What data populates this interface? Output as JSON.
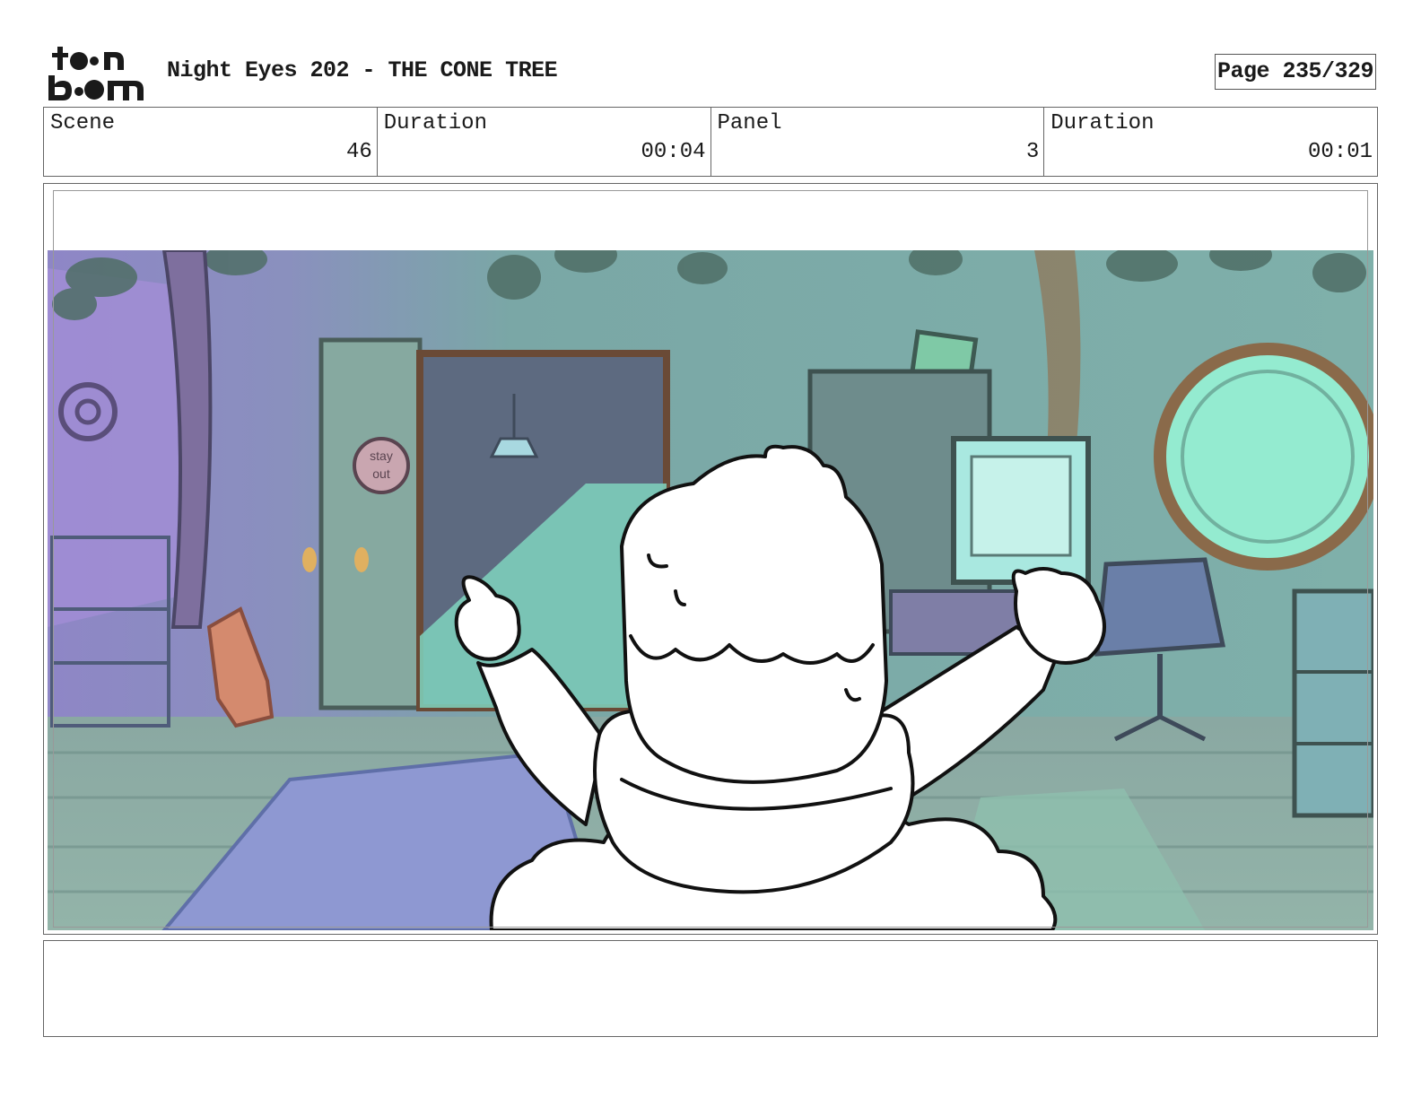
{
  "header": {
    "logo_text": "toon boom",
    "title": "Night Eyes 202 - THE CONE TREE",
    "page": "Page 235/329"
  },
  "info": {
    "scene_label": "Scene",
    "scene_value": "46",
    "scene_duration_label": "Duration",
    "scene_duration_value": "00:04",
    "panel_label": "Panel",
    "panel_value": "3",
    "panel_duration_label": "Duration",
    "panel_duration_value": "00:01"
  },
  "panel": {
    "sign_text_line1": "stay",
    "sign_text_line2": "out"
  },
  "notes": {
    "text": ""
  },
  "colors": {
    "room_teal": "#7fb3ad",
    "room_purple": "#8c84c8",
    "rug_blue": "#8b96cf",
    "monitor_green": "#9fe6d2",
    "ink": "#222222"
  }
}
